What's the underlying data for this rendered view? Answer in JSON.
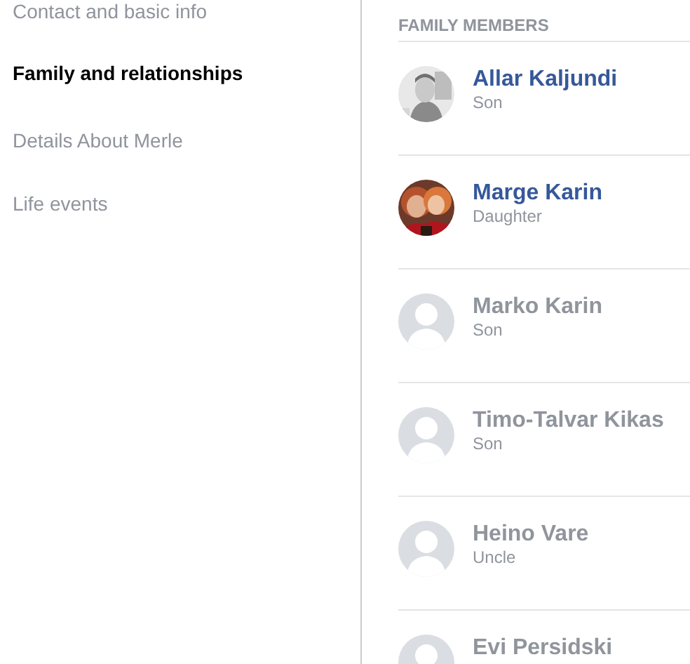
{
  "menu": [
    {
      "label": "Contact and basic info",
      "selected": false
    },
    {
      "label": "Family and relationships",
      "selected": true
    },
    {
      "label": "Details About Merle",
      "selected": false
    },
    {
      "label": "Life events",
      "selected": false
    }
  ],
  "family_members": {
    "title": "FAMILY MEMBERS",
    "members": [
      {
        "name": "Allar Kaljundi",
        "relation": "Son",
        "linked": true
      },
      {
        "name": "Marge Karin",
        "relation": "Daughter",
        "linked": true
      },
      {
        "name": "Marko Karin",
        "relation": "Son",
        "linked": false,
        "kind": "silhouette"
      },
      {
        "name": "Timo-Talvar Kikas",
        "relation": "Son",
        "linked": false,
        "kind": "silhouette"
      },
      {
        "name": "Heino Vare",
        "relation": "Uncle",
        "linked": false,
        "kind": "silhouette"
      },
      {
        "name": "Evi Persidski",
        "linked": false,
        "kind": "silhouette"
      }
    ]
  }
}
